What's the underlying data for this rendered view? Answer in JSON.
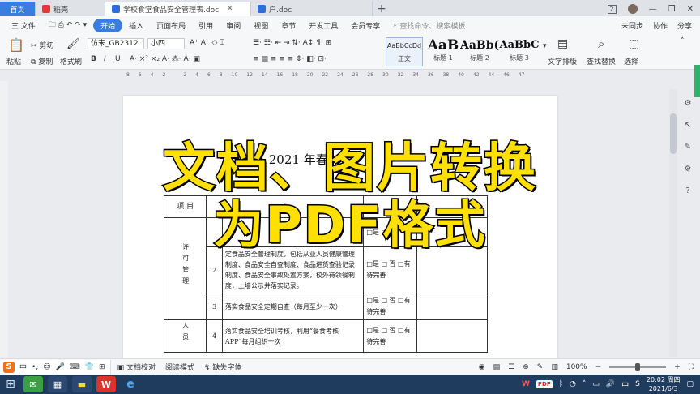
{
  "tabs": {
    "home": "首页",
    "items": [
      {
        "label": "稻壳",
        "icon": "daoke-icon",
        "color": "#e4393c"
      },
      {
        "label": "学校食堂食品安全管理表.doc",
        "icon": "doc-icon",
        "color": "#2d6fd6"
      },
      {
        "label": "户.doc",
        "icon": "doc-icon",
        "color": "#2d6fd6"
      }
    ],
    "window_badge": "2"
  },
  "menu": {
    "file": "三 文件",
    "items": [
      "开始",
      "插入",
      "页面布局",
      "引用",
      "审阅",
      "视图",
      "章节",
      "开发工具",
      "会员专享"
    ],
    "search_placeholder": "查找命令、搜索模板",
    "right": [
      "未同步",
      "协作",
      "分享"
    ]
  },
  "ribbon": {
    "paste": "粘贴",
    "cut": "剪切",
    "copy": "复制",
    "format_painter": "格式刷",
    "font_name": "仿宋_GB2312",
    "font_size": "小四",
    "styles": [
      {
        "preview": "AaBbCcDd",
        "label": "正文"
      },
      {
        "preview": "AaB",
        "label": "标题 1"
      },
      {
        "preview": "AaBb(",
        "label": "标题 2"
      },
      {
        "preview": "AaBbC",
        "label": "标题 3"
      }
    ],
    "text_layout": "文字排版",
    "find_replace": "查找替换",
    "select": "选择"
  },
  "ruler_ticks": [
    "8",
    "6",
    "4",
    "2",
    "",
    "2",
    "4",
    "6",
    "8",
    "10",
    "12",
    "14",
    "16",
    "18",
    "20",
    "22",
    "24",
    "26",
    "28",
    "30",
    "32",
    "34",
    "36",
    "38",
    "40",
    "42",
    "44",
    "46",
    "47"
  ],
  "document": {
    "title": "县 2021 年春",
    "table": {
      "header_col1": "项 目",
      "header_col2": "内",
      "row_category_1": "许可管理",
      "row_category_2": "人员",
      "rows": [
        {
          "num": "",
          "content": "",
          "options": "□是 □否"
        },
        {
          "num": "2",
          "content": "定食品安全管理制度，包括从业人员健康管理制度、食品安全自查制度、食品进货查验记录制度、食品安全事故处置方案，校外待领餐制度，上墙公示并落实记录。",
          "options": "□是 □ 否 □有待完善"
        },
        {
          "num": "3",
          "content": "落实食品安全定期自查（每月至少一次）",
          "options": "□是 □ 否 □有待完善"
        },
        {
          "num": "4",
          "content": "落实食品安全培训考核，利用“餐食考核APP”每月组织一次",
          "options": "□是 □ 否 □有待完善"
        }
      ]
    }
  },
  "overlay": {
    "line1": "文档、图片转换",
    "line2": "为PDF格式",
    "color": "#ffe000"
  },
  "statusbar": {
    "ime_label": "中",
    "proofread": "文档校对",
    "reading_mode": "阅读模式",
    "missing_font": "缺失字体",
    "zoom": "100%"
  },
  "taskbar": {
    "time": "20:02 周四",
    "date": "2021/6/3",
    "ime": "中"
  }
}
